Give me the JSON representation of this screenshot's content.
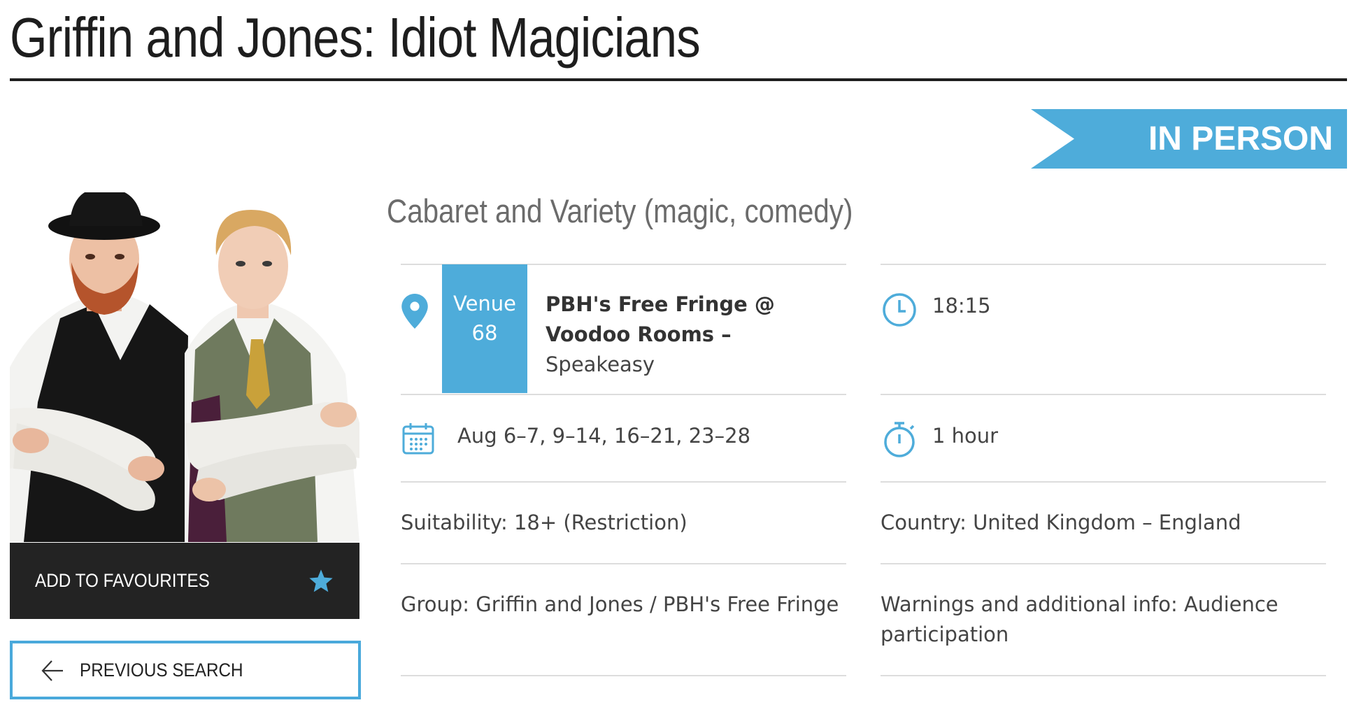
{
  "show": {
    "title": "Griffin and Jones: Idiot Magicians",
    "format_label": "IN PERSON",
    "genre": "Cabaret and Variety (magic, comedy)"
  },
  "actions": {
    "favourites_label": "ADD TO FAVOURITES",
    "previous_search_label": "PREVIOUS SEARCH"
  },
  "venue": {
    "badge_word": "Venue",
    "badge_number": "68",
    "name": "PBH's Free Fringe @ Voodoo Rooms",
    "separator": " –",
    "room": "Speakeasy"
  },
  "details": {
    "time": "18:15",
    "dates": "Aug 6–7, 9–14, 16–21, 23–28",
    "duration": "1 hour",
    "suitability": "Suitability: 18+ (Restriction)",
    "country": "Country: United Kingdom – England",
    "group": "Group: Griffin and Jones / PBH's Free Fringe",
    "warnings_line1": "Warnings and additional info: Audience",
    "warnings_line2": "participation"
  },
  "colors": {
    "accent": "#4eacda",
    "dark": "#232323",
    "title": "#1d1d1d",
    "genre": "#6b6b6b"
  },
  "icons": {
    "venue": "map-pin-icon",
    "time": "clock-icon",
    "dates": "calendar-icon",
    "duration": "stopwatch-icon",
    "favourite": "star-icon",
    "back": "arrow-left-icon"
  }
}
